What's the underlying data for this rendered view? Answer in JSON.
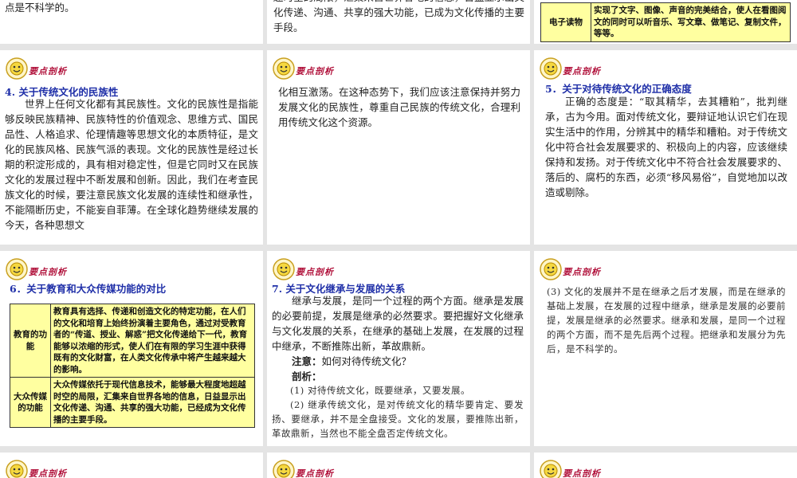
{
  "badge_label": "要点剖析",
  "row1": {
    "left_text": "点是不科学的。",
    "mid_text": "越时空的局限，汇集来自世界各地的信息，日益显示出文化传递、沟通、共享的强大功能，已成为文化传播的主要手段。",
    "right_table": {
      "label": "电子读物",
      "content": "实现了文字、图像、声音的完美结合，使人在看图阅文的同时可以听音乐、写文章、做笔记、复制文件，等等。"
    }
  },
  "row2": {
    "left": {
      "heading": "4. 关于传统文化的民族性",
      "body": "世界上任何文化都有其民族性。文化的民族性是指能够反映民族精神、民族特性的价值观念、思维方式、国民品性、人格追求、伦理情趣等思想文化的本质特征，是文化的民族风格、民族气派的表现。文化的民族性是经过长期的积淀形成的，具有相对稳定性，但是它同时又在民族文化的发展过程中不断发展和创新。因此，我们在考查民族文化的时候，要注意民族文化发展的连续性和继承性，不能隔断历史，不能妄自菲薄。在全球化趋势继续发展的今天，各种思想文"
    },
    "mid": {
      "body": "化相互激荡。在这种态势下，我们应该注意保持并努力发展文化的民族性，尊重自己民族的传统文化，合理利用传统文化这个资源。"
    },
    "right": {
      "heading": "5．关于对待传统文化的正确态度",
      "body": "正确的态度是：“取其精华，去其糟粕”，批判继承，古为今用。面对传统文化，要辩证地认识它们在现实生活中的作用，分辨其中的精华和糟粕。对于传统文化中符合社会发展要求的、积极向上的内容，应该继续保持和发扬。对于传统文化中不符合社会发展要求的、落后的、腐朽的东西，必须“移风易俗”，自觉地加以改造或剔除。"
    }
  },
  "row3": {
    "left": {
      "heading": "6．关于教育和大众传媒功能的对比",
      "table": [
        {
          "label": "教育的功能",
          "content": "教育具有选择、传递和创造文化的特定功能，在人们的文化和培育上始终扮演着主要角色，通过对受教育者的“传道、授业、解惑”把文化传递给下一代，教育能够以浓缩的形式，使人们在有限的学习生涯中获得既有的文化财富，在人类文化传承中将产生越来越大的影响。"
        },
        {
          "label": "大众传媒的功能",
          "content": "大众传媒依托于现代信息技术，能够最大程度地超越时空的局限，汇集来自世界各地的信息，日益显示出文化传递、沟通、共享的强大功能，已经成为文化传播的主要手段。"
        }
      ]
    },
    "mid": {
      "heading": "7. 关于文化继承与发展的关系",
      "body": "继承与发展，是同一个过程的两个方面。继承是发展的必要前提，发展是继承的必然要求。要把握好文化继承与文化发展的关系，在继承的基础上发展，在发展的过程中继承，不断推陈出新，革故鼎新。",
      "note_label": "注意：",
      "note_text": "如何对待传统文化？",
      "analysis_label": "剖析：",
      "point1": "(1) 对待传统文化，既要继承，又要发展。",
      "point2": "(2) 继承传统文化，是对传统文化的精华要肯定、要发扬、要继承，并不是全盘接受。文化的发展，要推陈出新，革故鼎新，当然也不能全盘否定传统文化。"
    },
    "right": {
      "point3": "(3) 文化的发展并不是在继承之后才发展，而是在继承的基础上发展，在发展的过程中继承，继承是发展的必要前提，发展是继承的必然要求。继承和发展，是同一个过程的两个方面，而不是先后两个过程。把继承和发展分为先后，是不科学的。"
    }
  }
}
